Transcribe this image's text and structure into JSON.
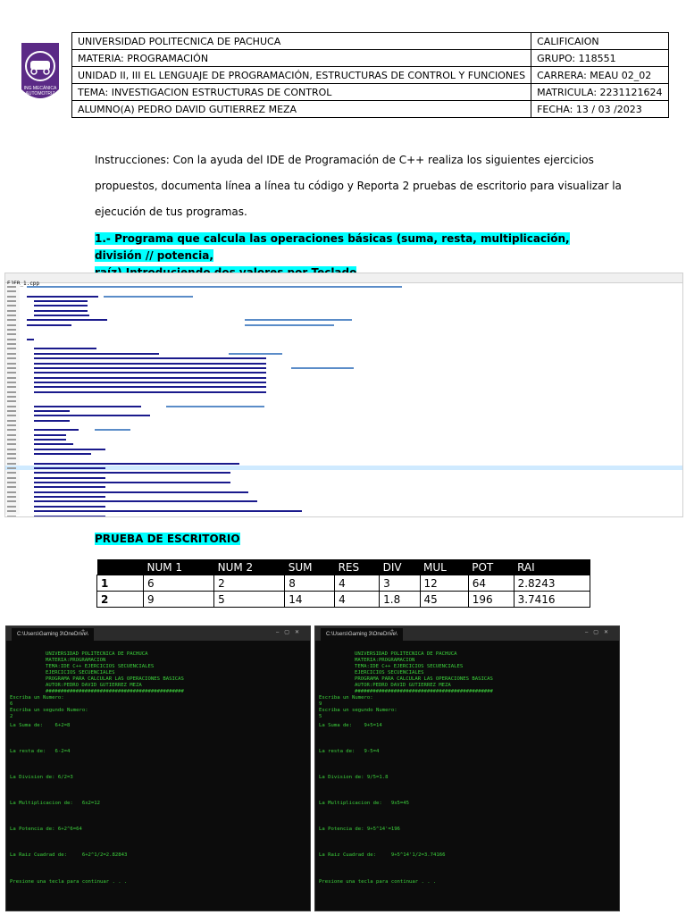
{
  "header": {
    "logo_text": "ING MECÁNICA AUTOMOTRIZ",
    "rows": [
      [
        "UNIVERSIDAD POLITECNICA DE PACHUCA",
        "CALIFICAION"
      ],
      [
        "MATERIA: PROGRAMACIÓN",
        "GRUPO: 118551"
      ],
      [
        "UNIDAD II, III EL LENGUAJE DE PROGRAMACIÓN, ESTRUCTURAS DE CONTROL Y FUNCIONES",
        "CARRERA: MEAU 02_02"
      ],
      [
        "TEMA: INVESTIGACION ESTRUCTURAS DE CONTROL",
        "MATRICULA: 2231121624"
      ],
      [
        "ALUMNO(A) PEDRO DAVID GUTIERREZ MEZA",
        "FECHA: 13 / 03 /2023"
      ]
    ]
  },
  "instructions": {
    "line1": "Instrucciones: Con la ayuda del IDE de Programación de C++ realiza los siguientes ejercicios",
    "line2": "propuestos, documenta línea a línea tu código y Reporta 2 pruebas de escritorio para visualizar la",
    "line3": "ejecución de tus programas."
  },
  "task": {
    "line1": "1.- Programa que calcula las operaciones básicas (suma, resta, multiplicación, división // potencia,",
    "line2": "raíz) Introduciendo dos valores por Teclado"
  },
  "code_screenshot": {
    "tab": "EJER_1.cpp",
    "colors": {
      "comment": "#5a8cc8",
      "keyword": "#1a1a8c",
      "string": "#1a1a8c",
      "highlight": "#cfeaff"
    }
  },
  "desk_test": {
    "title": "PRUEBA DE ESCRITORIO",
    "columns": [
      "",
      "NUM 1",
      "NUM 2",
      "SUM",
      "RES",
      "DIV",
      "MUL",
      "POT",
      "RAI"
    ],
    "rows": [
      [
        "1",
        "6",
        "2",
        "8",
        "4",
        "3",
        "12",
        "64",
        "2.8243"
      ],
      [
        "2",
        "9",
        "5",
        "14",
        "4",
        "1.8",
        "45",
        "196",
        "3.7416"
      ]
    ]
  },
  "terminals": [
    {
      "tab": "C:\\Users\\Gaming 3\\OneDrive\\",
      "lines": [
        "UNIVERSIDAD POLITECNICA DE PACHUCA",
        "MATERIA:PROGRAMACION",
        "TEMA:IDE C++ EJERCICIOS SECUENCIALES",
        "EJERCICIOS SECUENCIALES",
        "PROGRAMA PARA CALCULAR LAS OPERACIONES BASICAS",
        "AUTOR:PEDRO DAVID GUTIERREZ MEZA",
        "##############################################",
        "Escriba un Numero:",
        "6",
        "Escriba un segundo Numero:",
        "2",
        "La Suma de:    6+2=8",
        "La resta de:   6-2=4",
        "La Division de: 6/2=3",
        "La Multiplicacion de:   6x2=12",
        "La Potencia de: 6+2^6=64",
        "La Raiz Cuadrad de:     6+2^1/2=2.82843",
        "Presione una tecla para continuar . . ."
      ]
    },
    {
      "tab": "C:\\Users\\Gaming 3\\OneDrive\\",
      "lines": [
        "UNIVERSIDAD POLITECNICA DE PACHUCA",
        "MATERIA:PROGRAMACION",
        "TEMA:IDE C++ EJERCICIOS SECUENCIALES",
        "EJERCICIOS SECUENCIALES",
        "PROGRAMA PARA CALCULAR LAS OPERACIONES BASICAS",
        "AUTOR:PEDRO DAVID GUTIERREZ MEZA",
        "##############################################",
        "Escriba un Numero:",
        "9",
        "Escriba un segundo Numero:",
        "5",
        "La Suma de:    9+5=14",
        "La resta de:   9-5=4",
        "La Division de: 9/5=1.8",
        "La Multiplicacion de:   9x5=45",
        "La Potencia de: 9+5^14'=196",
        "La Raiz Cuadrad de:     9+5^14'1/2=3.74166",
        "Presione una tecla para continuar . . ."
      ]
    }
  ]
}
